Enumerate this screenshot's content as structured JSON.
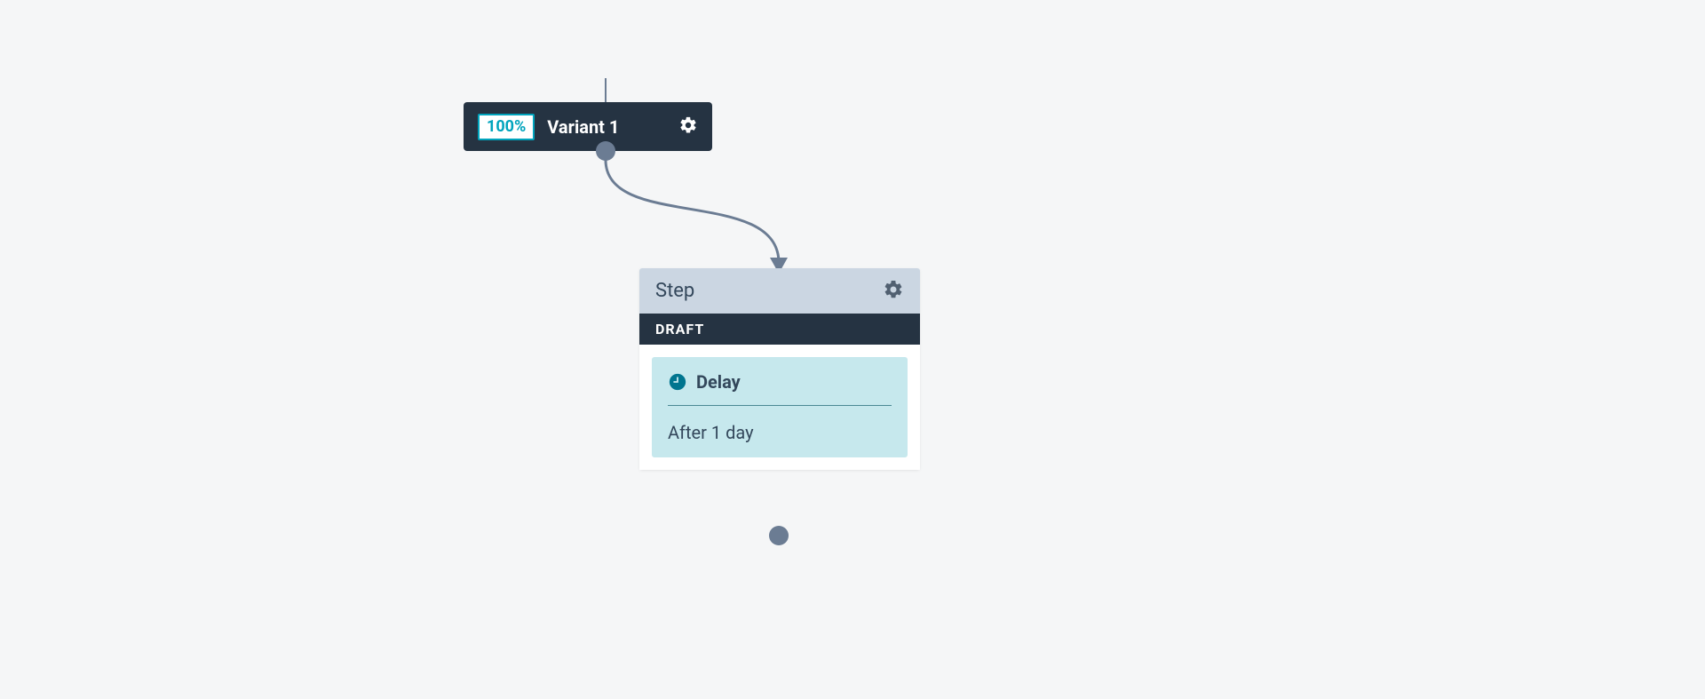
{
  "variant": {
    "percent": "100%",
    "label": "Variant 1"
  },
  "step": {
    "title": "Step",
    "status": "DRAFT",
    "action": {
      "type": "Delay",
      "value": "After 1 day"
    }
  }
}
